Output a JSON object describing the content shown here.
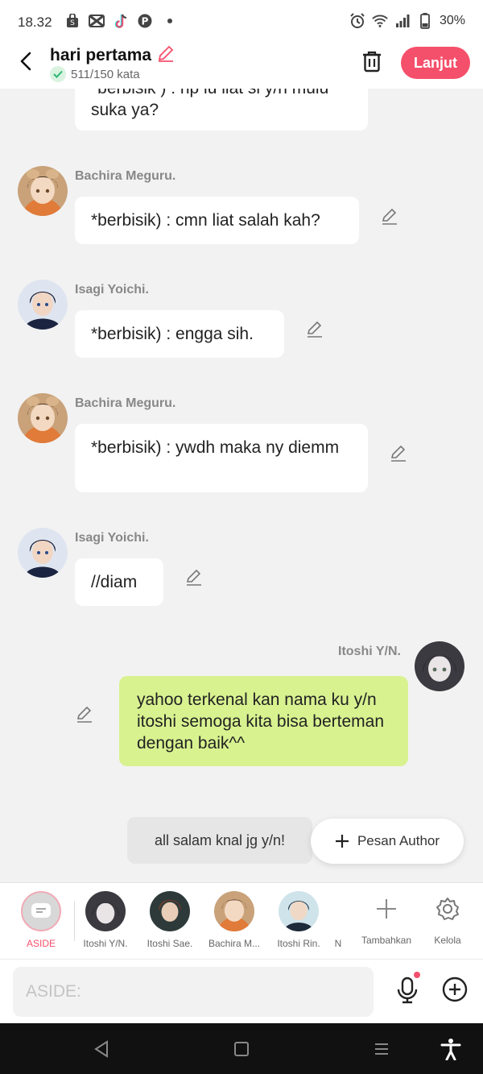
{
  "status": {
    "time": "18.32",
    "battery": "30%"
  },
  "header": {
    "title": "hari pertama",
    "word_count": "511/150 kata",
    "next_label": "Lanjut"
  },
  "messages": [
    {
      "type": "left",
      "name": "",
      "text": "*berbisik ) : np lu liat si y/n mulu suka ya?",
      "avatar": "bachira-avatar"
    },
    {
      "type": "left",
      "name": "Bachira Meguru.",
      "text": "*berbisik) : cmn liat salah kah?",
      "avatar": "bachira-avatar"
    },
    {
      "type": "left",
      "name": "Isagi Yoichi.",
      "text": "*berbisik) : engga sih.",
      "avatar": "isagi-avatar"
    },
    {
      "type": "left",
      "name": "Bachira Meguru.",
      "text": "*berbisik) : ywdh maka ny diemm",
      "avatar": "bachira-avatar"
    },
    {
      "type": "left",
      "name": "Isagi Yoichi.",
      "text": "//diam",
      "avatar": "isagi-avatar"
    },
    {
      "type": "right",
      "name": "Itoshi Y/N.",
      "text": "yahoo terkenal kan nama ku y/n itoshi semoga kita bisa berteman dengan baik^^",
      "avatar": "yn-avatar"
    }
  ],
  "aside_message": "all salam knal jg y/n!",
  "author_button": "Pesan Author",
  "characters": [
    {
      "label": "ASIDE",
      "icon": "aside-icon"
    },
    {
      "label": "Itoshi Y/N.",
      "icon": "yn-avatar"
    },
    {
      "label": "Itoshi Sae.",
      "icon": "sae-avatar"
    },
    {
      "label": "Bachira M...",
      "icon": "bachira-avatar"
    },
    {
      "label": "Itoshi Rin.",
      "icon": "rin-avatar"
    },
    {
      "label": "N",
      "icon": ""
    }
  ],
  "tools": {
    "add_label": "Tambahkan",
    "manage_label": "Kelola"
  },
  "input": {
    "placeholder": "ASIDE:"
  },
  "colors": {
    "accent": "#f5506b",
    "my_bubble": "#d8f290",
    "bubble": "#ffffff",
    "background": "#f2f2f2"
  }
}
